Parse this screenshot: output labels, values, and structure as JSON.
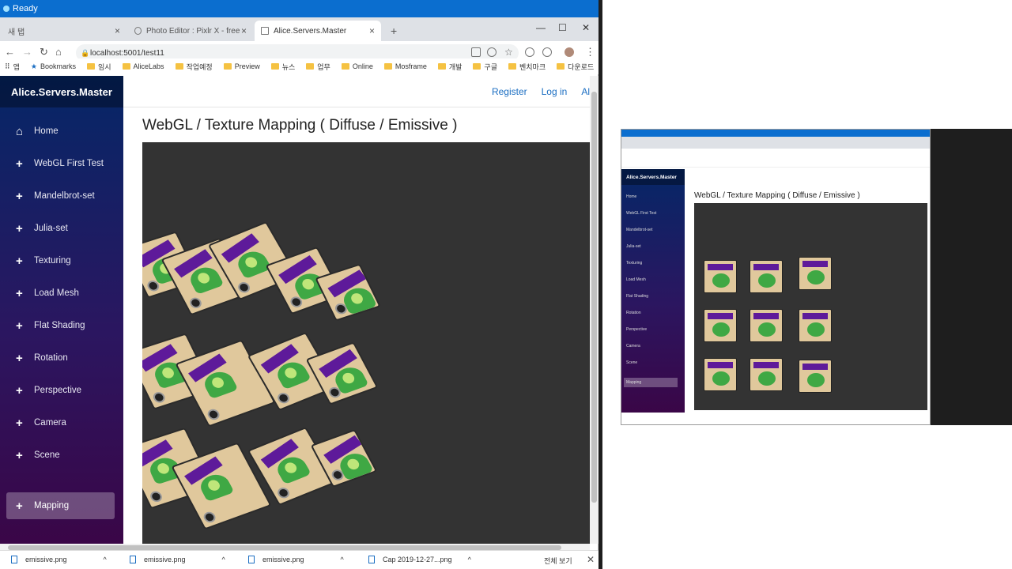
{
  "app_bar": {
    "status": "Ready"
  },
  "browser": {
    "tabs": [
      {
        "label": "새 탭"
      },
      {
        "label": "Photo Editor : Pixlr X - free ima"
      },
      {
        "label": "Alice.Servers.Master"
      }
    ],
    "new_tab": "+",
    "url": "localhost:5001/test11",
    "bookmarks": [
      "앱",
      "Bookmarks",
      "임시",
      "AliceLabs",
      "작업예정",
      "Preview",
      "뉴스",
      "업무",
      "Online",
      "Mosframe",
      "개발",
      "구글",
      "벤치마크",
      "다운로드"
    ],
    "bookmarks_more": "»"
  },
  "site": {
    "brand": "Alice.Servers.Master",
    "nav": [
      {
        "label": "Home",
        "icon": "home-icon",
        "active": false
      },
      {
        "label": "WebGL First Test",
        "icon": "plus-icon",
        "active": false
      },
      {
        "label": "Mandelbrot-set",
        "icon": "plus-icon",
        "active": false
      },
      {
        "label": "Julia-set",
        "icon": "plus-icon",
        "active": false
      },
      {
        "label": "Texturing",
        "icon": "plus-icon",
        "active": false
      },
      {
        "label": "Load Mesh",
        "icon": "plus-icon",
        "active": false
      },
      {
        "label": "Flat Shading",
        "icon": "plus-icon",
        "active": false
      },
      {
        "label": "Rotation",
        "icon": "plus-icon",
        "active": false
      },
      {
        "label": "Perspective",
        "icon": "plus-icon",
        "active": false
      },
      {
        "label": "Camera",
        "icon": "plus-icon",
        "active": false
      },
      {
        "label": "Scene",
        "icon": "plus-icon",
        "active": false
      },
      {
        "label": "Mapping",
        "icon": "plus-icon",
        "active": true
      }
    ],
    "top_links": {
      "register": "Register",
      "login": "Log in",
      "about": "Al"
    },
    "page_title": "WebGL / Texture Mapping ( Diffuse / Emissive )"
  },
  "downloads": {
    "items": [
      "emissive.png",
      "emissive.png",
      "emissive.png",
      "Cap 2019-12-27...png"
    ],
    "show_all": "전체 보기"
  },
  "colors": {
    "accent": "#1b6ec2",
    "sidebar_top": "#052767",
    "sidebar_bottom": "#3a0647",
    "canvas_bg": "#333333",
    "status_bar": "#0b6ecf"
  }
}
